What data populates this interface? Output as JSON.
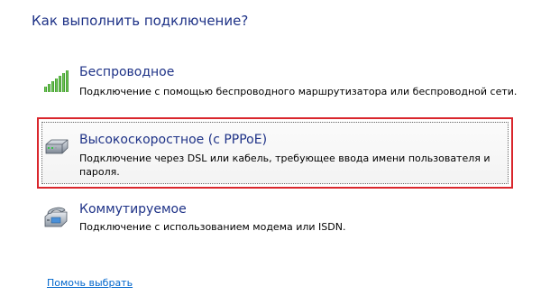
{
  "heading": "Как выполнить подключение?",
  "options": [
    {
      "title": "Беспроводное",
      "description": "Подключение с помощью беспроводного маршрутизатора или беспроводной сети.",
      "icon": "wireless-signal-icon"
    },
    {
      "title": "Высокоскоростное (с PPPoE)",
      "description": "Подключение через DSL или кабель, требующее ввода имени пользователя и пароля.",
      "icon": "broadband-modem-icon",
      "selected": true
    },
    {
      "title": "Коммутируемое",
      "description": "Подключение с использованием модема или ISDN.",
      "icon": "dialup-modem-icon"
    }
  ],
  "help_link": "Помочь выбрать",
  "colors": {
    "heading": "#1e3287",
    "link": "#0066cc",
    "highlight_border": "#d9262c"
  }
}
